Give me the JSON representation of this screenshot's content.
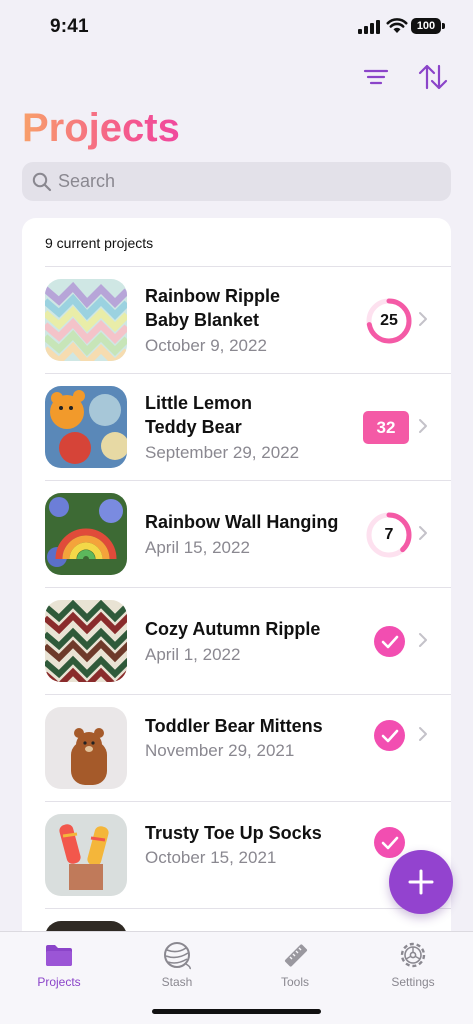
{
  "status_bar": {
    "time": "9:41",
    "battery": "100"
  },
  "toolbar": {
    "filter_icon": "filter-lines-icon",
    "sort_icon": "sort-arrows-icon"
  },
  "page_title": "Projects",
  "search": {
    "placeholder": "Search",
    "value": ""
  },
  "list": {
    "count_label": "9 current projects",
    "projects": [
      {
        "title_line1": "Rainbow Ripple",
        "title_line2": "Baby Blanket",
        "date": "October 9, 2022",
        "indicator": "ring",
        "value": "25",
        "progress": 0.72
      },
      {
        "title_line1": "Little Lemon",
        "title_line2": "Teddy Bear",
        "date": "September 29, 2022",
        "indicator": "badge",
        "value": "32"
      },
      {
        "title_line1": "Rainbow Wall Hanging",
        "title_line2": "",
        "date": "April 15, 2022",
        "indicator": "ring",
        "value": "7",
        "progress": 0.38
      },
      {
        "title_line1": "Cozy Autumn Ripple",
        "title_line2": "",
        "date": "April 1, 2022",
        "indicator": "check"
      },
      {
        "title_line1": "Toddler Bear Mittens",
        "title_line2": "",
        "date": "November 29, 2021",
        "indicator": "check"
      },
      {
        "title_line1": "Trusty Toe Up Socks",
        "title_line2": "",
        "date": "October 15, 2021",
        "indicator": "check"
      }
    ]
  },
  "fab_icon": "plus-icon",
  "tabs": [
    {
      "label": "Projects",
      "icon": "folder-icon",
      "active": true
    },
    {
      "label": "Stash",
      "icon": "yarn-ball-icon",
      "active": false
    },
    {
      "label": "Tools",
      "icon": "ruler-icon",
      "active": false
    },
    {
      "label": "Settings",
      "icon": "gear-icon",
      "active": false
    }
  ],
  "colors": {
    "accent_purple": "#9343cf",
    "accent_pink": "#f45aa6",
    "title_gradient_start": "#f8a06a",
    "title_gradient_end": "#f0489e"
  }
}
